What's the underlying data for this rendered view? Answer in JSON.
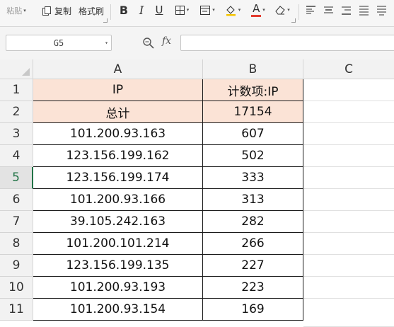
{
  "toolbar": {
    "paste_label": "粘贴",
    "copy_label": "复制",
    "format_painter_label": "格式刷",
    "bold_glyph": "B",
    "italic_glyph": "I",
    "underline_glyph": "U",
    "font_color_glyph": "A",
    "accent_red": "#e23b2e"
  },
  "formula_bar": {
    "name_box_value": "G5",
    "fx_label": "fx",
    "formula_value": ""
  },
  "grid": {
    "column_headers": [
      "A",
      "B",
      "C"
    ],
    "row_headers": [
      "1",
      "2",
      "3",
      "4",
      "5",
      "6",
      "7",
      "8",
      "9",
      "10",
      "11"
    ],
    "active_row": "5",
    "header_fill": "#fbe3d6",
    "rows": [
      {
        "a": "IP",
        "b": "计数项:IP"
      },
      {
        "a": "总计",
        "b": "17154"
      },
      {
        "a": "101.200.93.163",
        "b": "607"
      },
      {
        "a": "123.156.199.162",
        "b": "502"
      },
      {
        "a": "123.156.199.174",
        "b": "333"
      },
      {
        "a": "101.200.93.166",
        "b": "313"
      },
      {
        "a": "39.105.242.163",
        "b": "282"
      },
      {
        "a": "101.200.101.214",
        "b": "266"
      },
      {
        "a": "123.156.199.135",
        "b": "227"
      },
      {
        "a": "101.200.93.193",
        "b": "223"
      },
      {
        "a": "101.200.93.154",
        "b": "169"
      }
    ]
  }
}
